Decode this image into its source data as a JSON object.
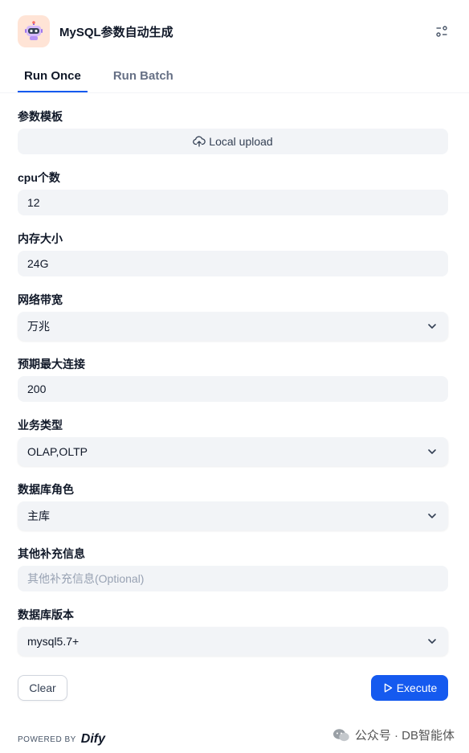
{
  "app": {
    "title": "MySQL参数自动生成",
    "icon": "robot-icon"
  },
  "tabs": [
    {
      "label": "Run Once",
      "active": true
    },
    {
      "label": "Run Batch",
      "active": false
    }
  ],
  "fields": {
    "template": {
      "label": "参数模板",
      "upload_label": "Local upload"
    },
    "cpu": {
      "label": "cpu个数",
      "value": "12"
    },
    "memory": {
      "label": "内存大小",
      "value": "24G"
    },
    "bandwidth": {
      "label": "网络带宽",
      "value": "万兆"
    },
    "max_connections": {
      "label": "预期最大连接",
      "value": "200"
    },
    "business_type": {
      "label": "业务类型",
      "value": "OLAP,OLTP"
    },
    "db_role": {
      "label": "数据库角色",
      "value": "主库"
    },
    "extra_info": {
      "label": "其他补充信息",
      "placeholder": "其他补充信息(Optional)"
    },
    "db_version": {
      "label": "数据库版本",
      "value": "mysql5.7+"
    }
  },
  "actions": {
    "clear_label": "Clear",
    "execute_label": "Execute"
  },
  "footer": {
    "powered_by": "POWERED BY",
    "brand": "Dify",
    "watermark": "公众号 · DB智能体"
  },
  "colors": {
    "primary": "#155aef",
    "input_bg": "#f2f4f7",
    "app_icon_bg": "#ffe4d6"
  }
}
